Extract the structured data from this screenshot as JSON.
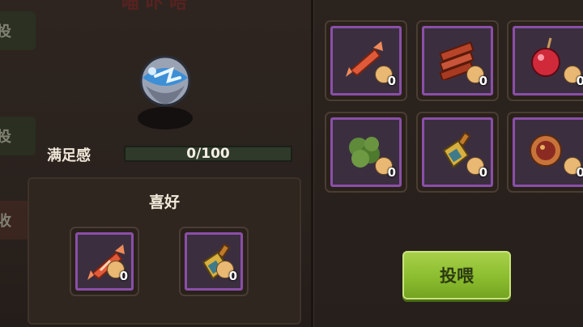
{
  "top_deco_text": "喵 卟 哈",
  "side_tabs": [
    {
      "label": "投"
    },
    {
      "label": "投"
    },
    {
      "label": "收"
    }
  ],
  "satiety": {
    "label": "满足感",
    "value": 0,
    "max": 100,
    "text": "0/100"
  },
  "preference": {
    "title": "喜好",
    "items": [
      {
        "icon": "candy-icon",
        "count": "0"
      },
      {
        "icon": "sauce-bottle-icon",
        "count": "0"
      }
    ]
  },
  "inventory": {
    "items": [
      {
        "icon": "candy-icon",
        "count": "0"
      },
      {
        "icon": "jerky-icon",
        "count": "0"
      },
      {
        "icon": "candy-apple-icon",
        "count": "0"
      },
      {
        "icon": "herb-icon",
        "count": "0"
      },
      {
        "icon": "sauce-bottle-icon",
        "count": "0"
      },
      {
        "icon": "cookie-icon",
        "count": "0"
      }
    ]
  },
  "feed_button": {
    "label": "投喂"
  },
  "colors": {
    "accent_green": "#8fc43a",
    "slot_border_purple": "#8a4fa8"
  }
}
